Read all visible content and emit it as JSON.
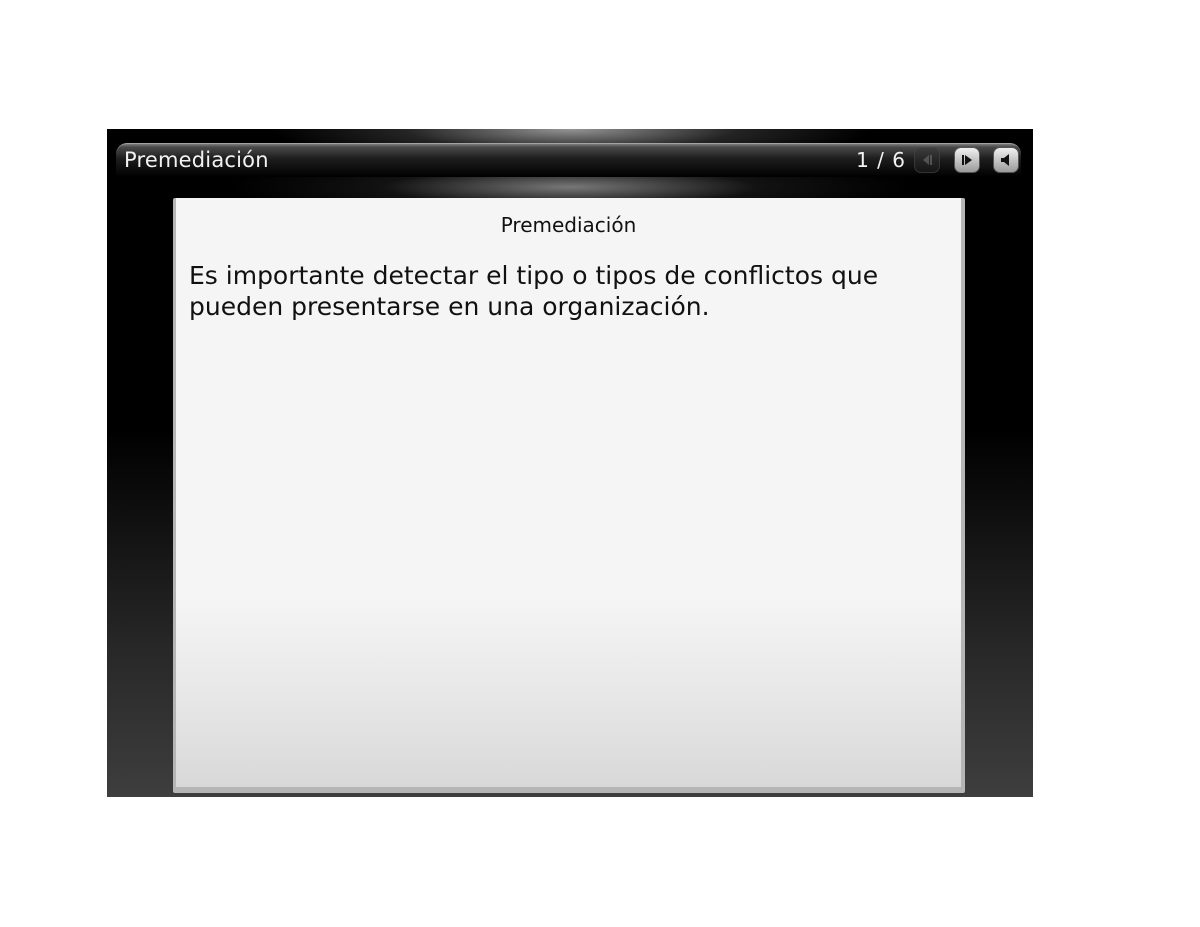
{
  "window": {
    "title": "Premediación",
    "page_counter": "1 / 6"
  },
  "controls": {
    "prev_icon": "prev-icon",
    "next_icon": "next-icon",
    "sound_icon": "speaker-icon"
  },
  "slide": {
    "title": "Premediación",
    "body": "Es importante detectar el tipo o tipos de conflictos que pueden presentarse en una organización."
  },
  "colors": {
    "chrome": "#000000",
    "slide_background": "#f5f5f5",
    "text": "#111111"
  }
}
